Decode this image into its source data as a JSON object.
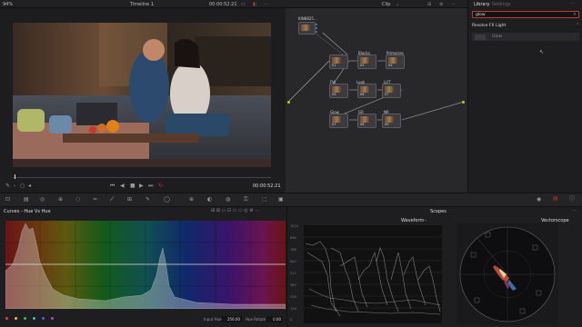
{
  "top_bar": {
    "zoom": "94%",
    "timeline_name": "Timeline 1",
    "timecode": "00:00:52:21",
    "clip_label": "Clip"
  },
  "viewer": {
    "timecode": "00:00:52:21"
  },
  "node_graph": {
    "source_label": "KIN8825...",
    "nodes": [
      {
        "label": "",
        "num": "01"
      },
      {
        "label": "Blacks",
        "num": "03"
      },
      {
        "label": "Primaries",
        "num": "04"
      },
      {
        "label": "FW",
        "num": "05"
      },
      {
        "label": "Look",
        "num": "06"
      },
      {
        "label": "LUT",
        "num": "07"
      },
      {
        "label": "Glow",
        "num": "07"
      },
      {
        "label": "GR",
        "num": "08"
      },
      {
        "label": "NR",
        "num": "09"
      }
    ]
  },
  "library": {
    "tab_library": "Library",
    "tab_settings": "Settings",
    "search_value": "glow",
    "section_title": "Resolve FX Light",
    "result_item": "Glow"
  },
  "curves": {
    "title": "Curves - Hue Vs Hue",
    "input_hue_label": "Input Hue",
    "input_hue_value": "256.00",
    "hue_rotate_label": "Hue Rotate",
    "hue_rotate_value": "0.00",
    "swatch_colors": [
      "#e04040",
      "#e0c040",
      "#40c040",
      "#40c0c0",
      "#4060e0",
      "#c040c0"
    ]
  },
  "scopes": {
    "title": "Scopes",
    "waveform_label": "Waveform",
    "vectorscope_label": "Vectorscope",
    "waveform_scale": [
      "1023",
      "896",
      "768",
      "640",
      "512",
      "384",
      "256",
      "128",
      "0"
    ]
  }
}
